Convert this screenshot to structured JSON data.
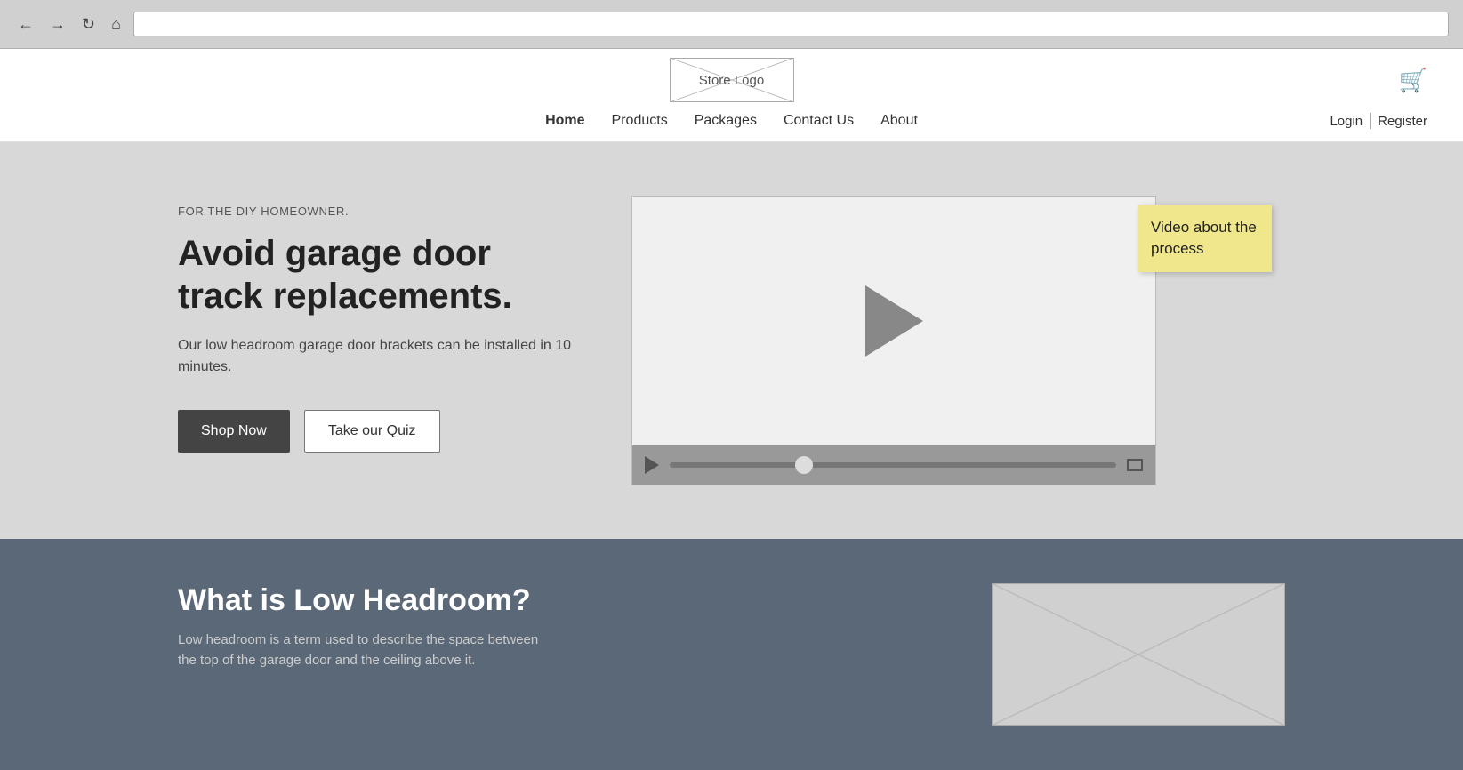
{
  "browser": {
    "back_label": "←",
    "forward_label": "→",
    "reload_label": "↻",
    "home_label": "⌂",
    "address_placeholder": ""
  },
  "header": {
    "logo_text": "Store Logo",
    "cart_icon": "🛒",
    "nav": [
      {
        "label": "Home",
        "active": true
      },
      {
        "label": "Products",
        "active": false
      },
      {
        "label": "Packages",
        "active": false
      },
      {
        "label": "Contact Us",
        "active": false
      },
      {
        "label": "About",
        "active": false
      }
    ],
    "login_label": "Login",
    "register_label": "Register"
  },
  "hero": {
    "subtitle": "FOR THE DIY HOMEOWNER.",
    "title": "Avoid garage door track replacements.",
    "description": "Our low headroom garage door brackets can be installed in 10 minutes.",
    "shop_now_label": "Shop Now",
    "quiz_label": "Take our Quiz"
  },
  "video": {
    "annotation": "Video about the process"
  },
  "lower": {
    "title": "What is Low Headroom?",
    "description": "Low headroom is a term used to describe the space between the top of the garage door and the ceiling above it."
  }
}
